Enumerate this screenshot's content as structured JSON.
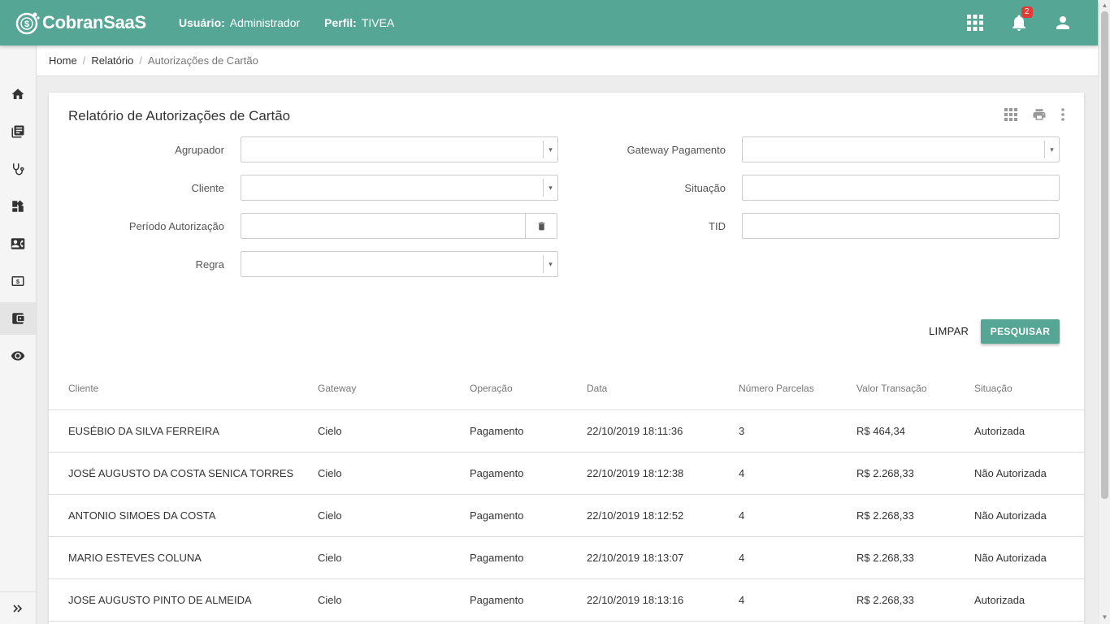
{
  "header": {
    "app_name": "CobranSaaS",
    "user_label": "Usuário:",
    "user_value": "Administrador",
    "profile_label": "Perfil:",
    "profile_value": "TIVEA",
    "notifications_count": "2",
    "brand_color": "#56a696"
  },
  "sidebar": {
    "items": [
      {
        "icon": "home-icon"
      },
      {
        "icon": "library-icon"
      },
      {
        "icon": "stethoscope-icon"
      },
      {
        "icon": "dashboard-icon"
      },
      {
        "icon": "contact-card-icon"
      },
      {
        "icon": "money-icon"
      },
      {
        "icon": "wallet-icon",
        "active": true
      },
      {
        "icon": "eye-icon"
      }
    ],
    "expand_icon": "chevrons-right-icon"
  },
  "breadcrumb": {
    "home": "Home",
    "section": "Relatório",
    "current": "Autorizações de Cartão"
  },
  "report": {
    "title": "Relatório de Autorizações de Cartão",
    "filters": {
      "agrupador": {
        "label": "Agrupador",
        "value": ""
      },
      "cliente": {
        "label": "Cliente",
        "value": ""
      },
      "periodo": {
        "label": "Período Autorização",
        "value": ""
      },
      "regra": {
        "label": "Regra",
        "value": ""
      },
      "gateway": {
        "label": "Gateway Pagamento",
        "value": ""
      },
      "situacao": {
        "label": "Situação",
        "value": ""
      },
      "tid": {
        "label": "TID",
        "value": ""
      }
    },
    "clear_label": "LIMPAR",
    "search_label": "PESQUISAR"
  },
  "table": {
    "columns": [
      "Cliente",
      "Gateway",
      "Operação",
      "Data",
      "Número Parcelas",
      "Valor Transação",
      "Situação"
    ],
    "rows": [
      [
        "EUSÉBIO DA SILVA FERREIRA",
        "Cielo",
        "Pagamento",
        "22/10/2019 18:11:36",
        "3",
        "R$ 464,34",
        "Autorizada"
      ],
      [
        "JOSÉ AUGUSTO DA COSTA SENICA TORRES",
        "Cielo",
        "Pagamento",
        "22/10/2019 18:12:38",
        "4",
        "R$ 2.268,33",
        "Não Autorizada"
      ],
      [
        "ANTONIO SIMOES DA COSTA",
        "Cielo",
        "Pagamento",
        "22/10/2019 18:12:52",
        "4",
        "R$ 2.268,33",
        "Não Autorizada"
      ],
      [
        "MARIO ESTEVES COLUNA",
        "Cielo",
        "Pagamento",
        "22/10/2019 18:13:07",
        "4",
        "R$ 2.268,33",
        "Não Autorizada"
      ],
      [
        "JOSE AUGUSTO PINTO DE ALMEIDA",
        "Cielo",
        "Pagamento",
        "22/10/2019 18:13:16",
        "4",
        "R$ 2.268,33",
        "Autorizada"
      ]
    ]
  }
}
